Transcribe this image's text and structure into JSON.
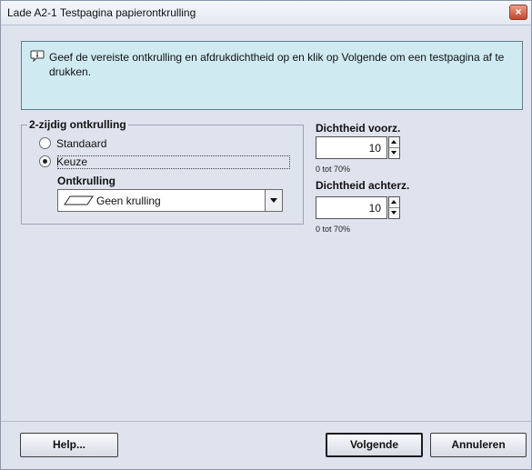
{
  "window": {
    "title": "Lade A2-1 Testpagina papierontkrulling",
    "close_label": "×"
  },
  "info": {
    "icon": "speech-bubble-info-icon",
    "text": "Geef de vereiste ontkrulling en afdrukdichtheid op en klik op Volgende om een testpagina af te drukken."
  },
  "duplex_group": {
    "legend": "2-zijdig ontkrulling",
    "options": [
      {
        "label": "Standaard",
        "selected": false
      },
      {
        "label": "Keuze",
        "selected": true
      }
    ],
    "decurl_label": "Ontkrulling",
    "decurl_value": "Geen krulling",
    "decurl_icon": "flat-paper-icon"
  },
  "density_front": {
    "label": "Dichtheid voorz.",
    "value": "10",
    "range": "0 tot 70%"
  },
  "density_back": {
    "label": "Dichtheid achterz.",
    "value": "10",
    "range": "0 tot 70%"
  },
  "buttons": {
    "help": "Help...",
    "next": "Volgende",
    "cancel": "Annuleren"
  },
  "colors": {
    "dialog_bg": "#dfe3ee",
    "info_bg": "#cfeaf1",
    "close_btn": "#c6452c"
  }
}
